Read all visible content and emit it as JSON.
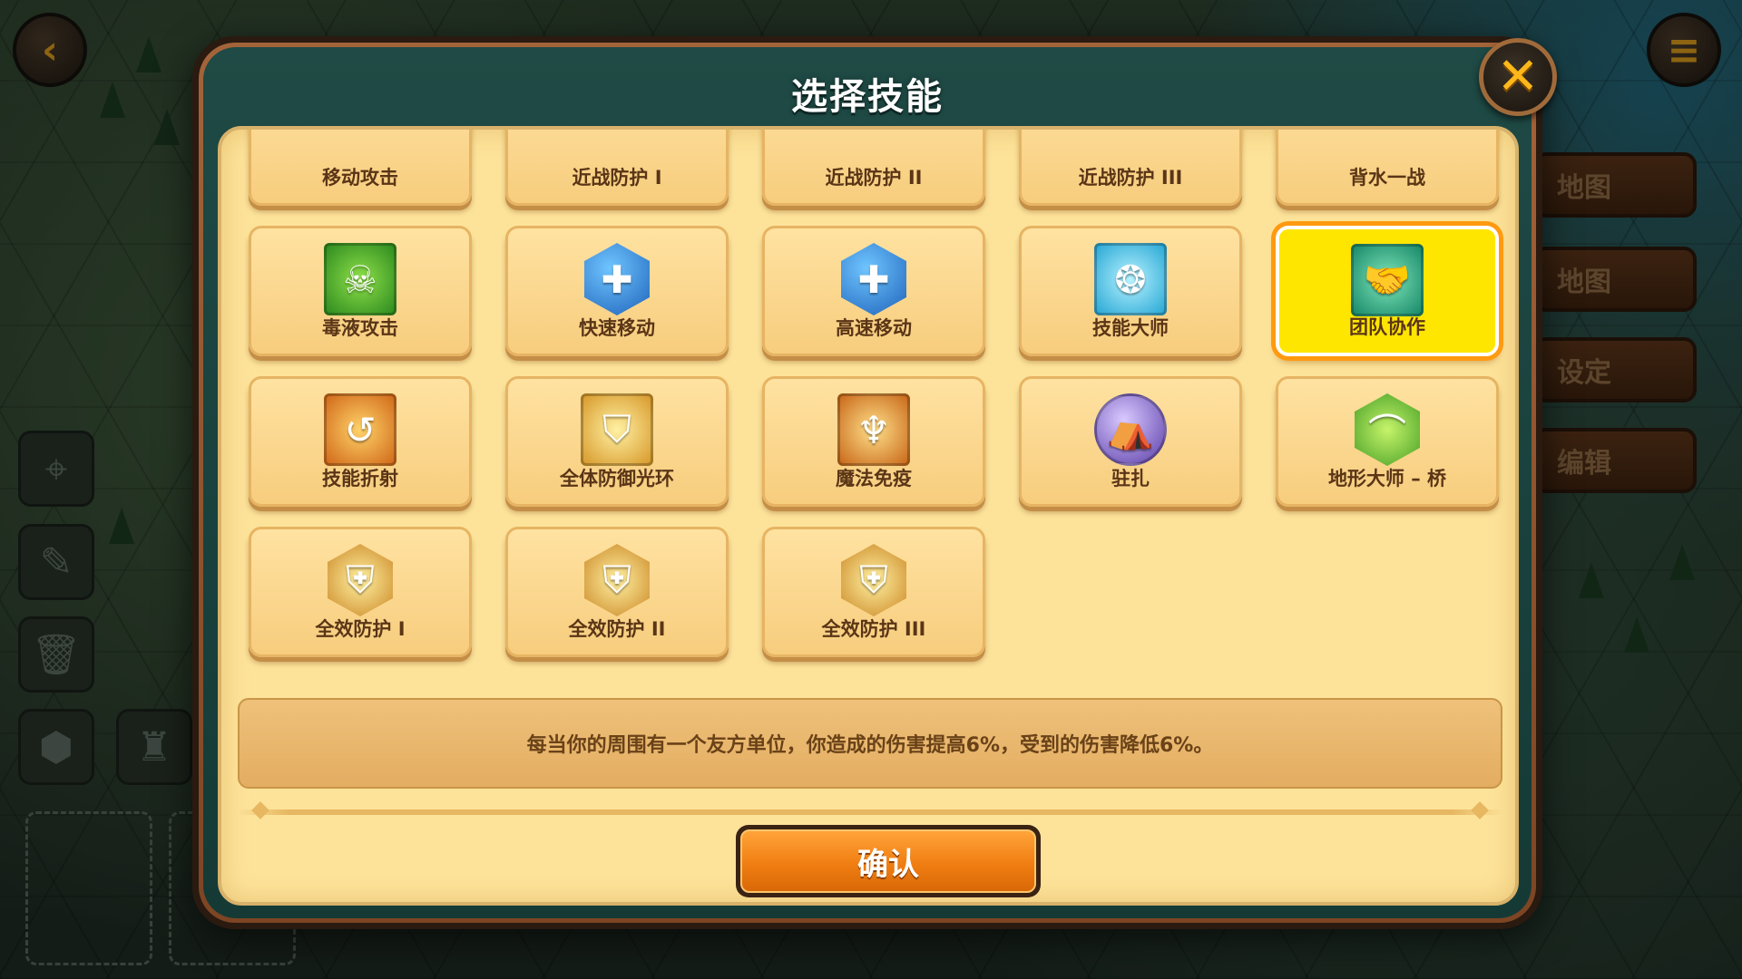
{
  "dialog": {
    "title": "选择技能",
    "confirm_label": "确认",
    "description": "每当你的周围有一个友方单位，你造成的伤害提高6%，受到的伤害降低6%。"
  },
  "background": {
    "right_menu": [
      "地图",
      "地图",
      "设定",
      "编辑"
    ]
  },
  "skills": [
    {
      "label": "移动攻击",
      "icon": "move-attack-icon",
      "glyph": "",
      "style": "none",
      "color": "",
      "selected": false
    },
    {
      "label": "近战防护 I",
      "icon": "melee-guard-1-icon",
      "glyph": "",
      "style": "none",
      "color": "",
      "selected": false
    },
    {
      "label": "近战防护 II",
      "icon": "melee-guard-2-icon",
      "glyph": "",
      "style": "none",
      "color": "",
      "selected": false
    },
    {
      "label": "近战防护 III",
      "icon": "melee-guard-3-icon",
      "glyph": "",
      "style": "none",
      "color": "",
      "selected": false
    },
    {
      "label": "背水一战",
      "icon": "last-stand-icon",
      "glyph": "",
      "style": "none",
      "color": "",
      "selected": false
    },
    {
      "label": "毒液攻击",
      "icon": "skull-poison-icon",
      "glyph": "☠",
      "style": "sq",
      "color": "ic-green",
      "selected": false
    },
    {
      "label": "快速移动",
      "icon": "boot-plus-icon",
      "glyph": "✚",
      "style": "hex",
      "color": "ic-blue-hex",
      "selected": false
    },
    {
      "label": "高速移动",
      "icon": "boot-double-plus-icon",
      "glyph": "✚",
      "style": "hex",
      "color": "ic-blue-hex",
      "selected": false
    },
    {
      "label": "技能大师",
      "icon": "skill-book-icon",
      "glyph": "❂",
      "style": "sq",
      "color": "ic-cyan",
      "selected": false
    },
    {
      "label": "团队协作",
      "icon": "handshake-icon",
      "glyph": "🤝",
      "style": "sq",
      "color": "ic-teal",
      "selected": true
    },
    {
      "label": "技能折射",
      "icon": "deflect-icon",
      "glyph": "↺",
      "style": "sq",
      "color": "ic-orange",
      "selected": false
    },
    {
      "label": "全体防御光环",
      "icon": "shield-aura-icon",
      "glyph": "⛉",
      "style": "sq",
      "color": "ic-gold",
      "selected": false
    },
    {
      "label": "魔法免疫",
      "icon": "magic-immune-icon",
      "glyph": "♆",
      "style": "sq",
      "color": "ic-amber",
      "selected": false
    },
    {
      "label": "驻扎",
      "icon": "tent-icon",
      "glyph": "⛺",
      "style": "circ",
      "color": "ic-purple",
      "selected": false
    },
    {
      "label": "地形大师 – 桥",
      "icon": "bridge-icon",
      "glyph": "⌒",
      "style": "hex",
      "color": "ic-lime-hex",
      "selected": false
    },
    {
      "label": "全效防护 I",
      "icon": "full-guard-1-icon",
      "glyph": "⛨",
      "style": "hex",
      "color": "ic-gold-hex",
      "selected": false
    },
    {
      "label": "全效防护 II",
      "icon": "full-guard-2-icon",
      "glyph": "⛨",
      "style": "hex",
      "color": "ic-gold-hex",
      "selected": false
    },
    {
      "label": "全效防护 III",
      "icon": "full-guard-3-icon",
      "glyph": "⛨",
      "style": "hex",
      "color": "ic-gold-hex",
      "selected": false
    }
  ],
  "colors": {
    "panel": "#fde39a",
    "tile": "#f7cd7e",
    "selected_tile": "#ffe600",
    "selected_border": "#ff9a10",
    "confirm": "#f07e12",
    "title_bar": "#1f4a45"
  }
}
